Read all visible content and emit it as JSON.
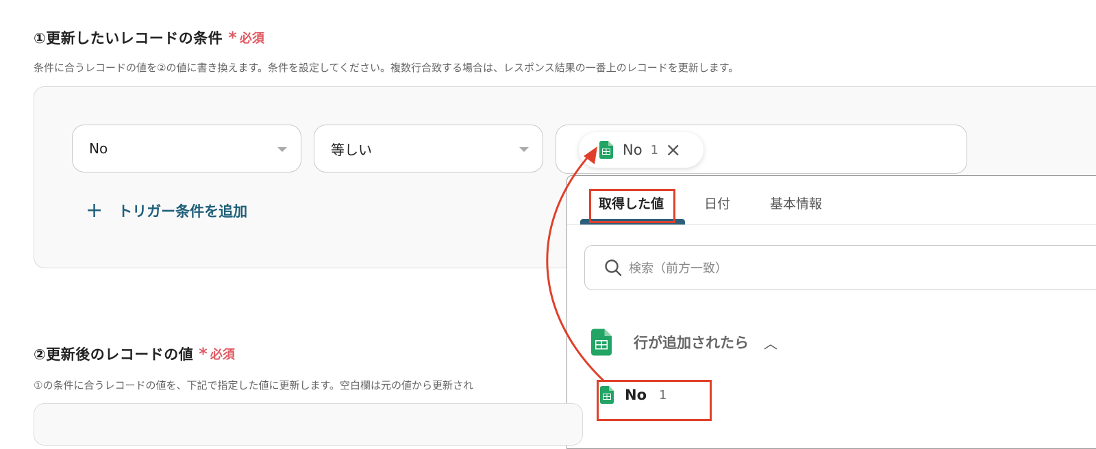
{
  "section1": {
    "title": "①更新したいレコードの条件",
    "required": "必須",
    "description": "条件に合うレコードの値を②の値に書き換えます。条件を設定してください。複数行合致する場合は、レスポンス結果の一番上のレコードを更新します。",
    "field_select": "No",
    "operator_select": "等しい",
    "chip": {
      "name": "No",
      "num": "1"
    },
    "add_condition": "トリガー条件を追加"
  },
  "panel": {
    "tabs": [
      "取得した値",
      "日付",
      "基本情報"
    ],
    "search_placeholder": "検索（前方一致）",
    "group_title": "行が追加されたら",
    "item": {
      "name": "No",
      "num": "1"
    }
  },
  "section2": {
    "title": "②更新後のレコードの値",
    "required": "必須",
    "description": "①の条件に合うレコードの値を、下記で指定した値に更新します。空白欄は元の値から更新され"
  },
  "colors": {
    "required": "#e05a62",
    "accent": "#1f5f7a",
    "highlight": "#e0402a",
    "sheets_green": "#21a464"
  }
}
